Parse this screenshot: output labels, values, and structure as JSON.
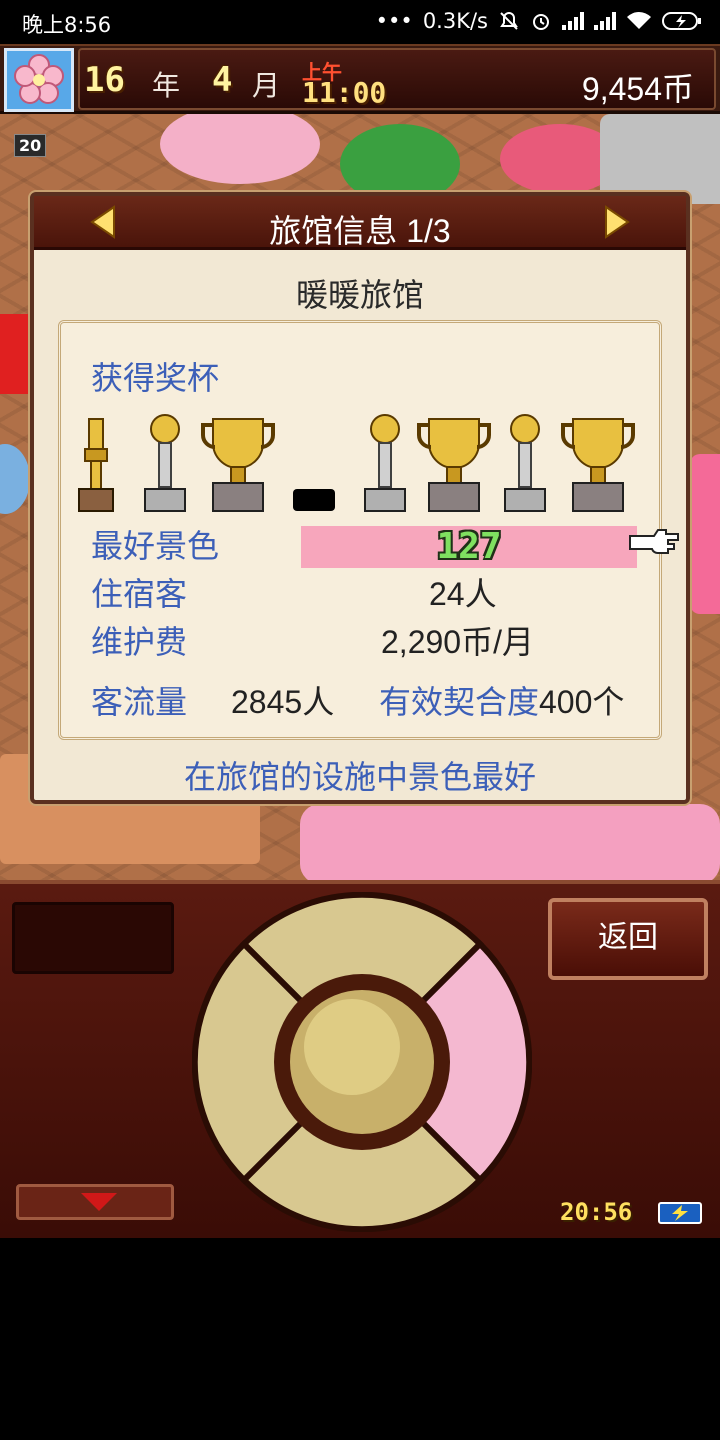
{
  "status_bar": {
    "time": "晚上8:56",
    "dots": "•••",
    "net_speed": "0.3K/s"
  },
  "game_header": {
    "year_num": "16",
    "year_unit": "年",
    "month_num": "4",
    "month_unit": "月",
    "ampm": "上午",
    "clock": "11:00",
    "money": "9,454币",
    "level_badge": "20"
  },
  "panel": {
    "title": "旅馆信息 1/3",
    "inn_name": "暖暖旅馆",
    "trophies_label": "获得奖杯",
    "best_scenery_label": "最好景色",
    "best_scenery_value": "127",
    "guests_label": "住宿客",
    "guests_value": "24人",
    "upkeep_label": "维护费",
    "upkeep_value": "2,290币/月",
    "traffic_label": "客流量",
    "traffic_value": "2845人",
    "fit_label": "有效契合度",
    "fit_value": "400个",
    "description": "在旅馆的设施中景色最好"
  },
  "controller": {
    "back_label": "返回",
    "clock": "20:56"
  },
  "colors": {
    "label_blue": "#3c5fb8",
    "scenery_pink": "#f7a6bc",
    "panel_bg": "#f2e8d4",
    "header_brown": "#5a1c10"
  }
}
